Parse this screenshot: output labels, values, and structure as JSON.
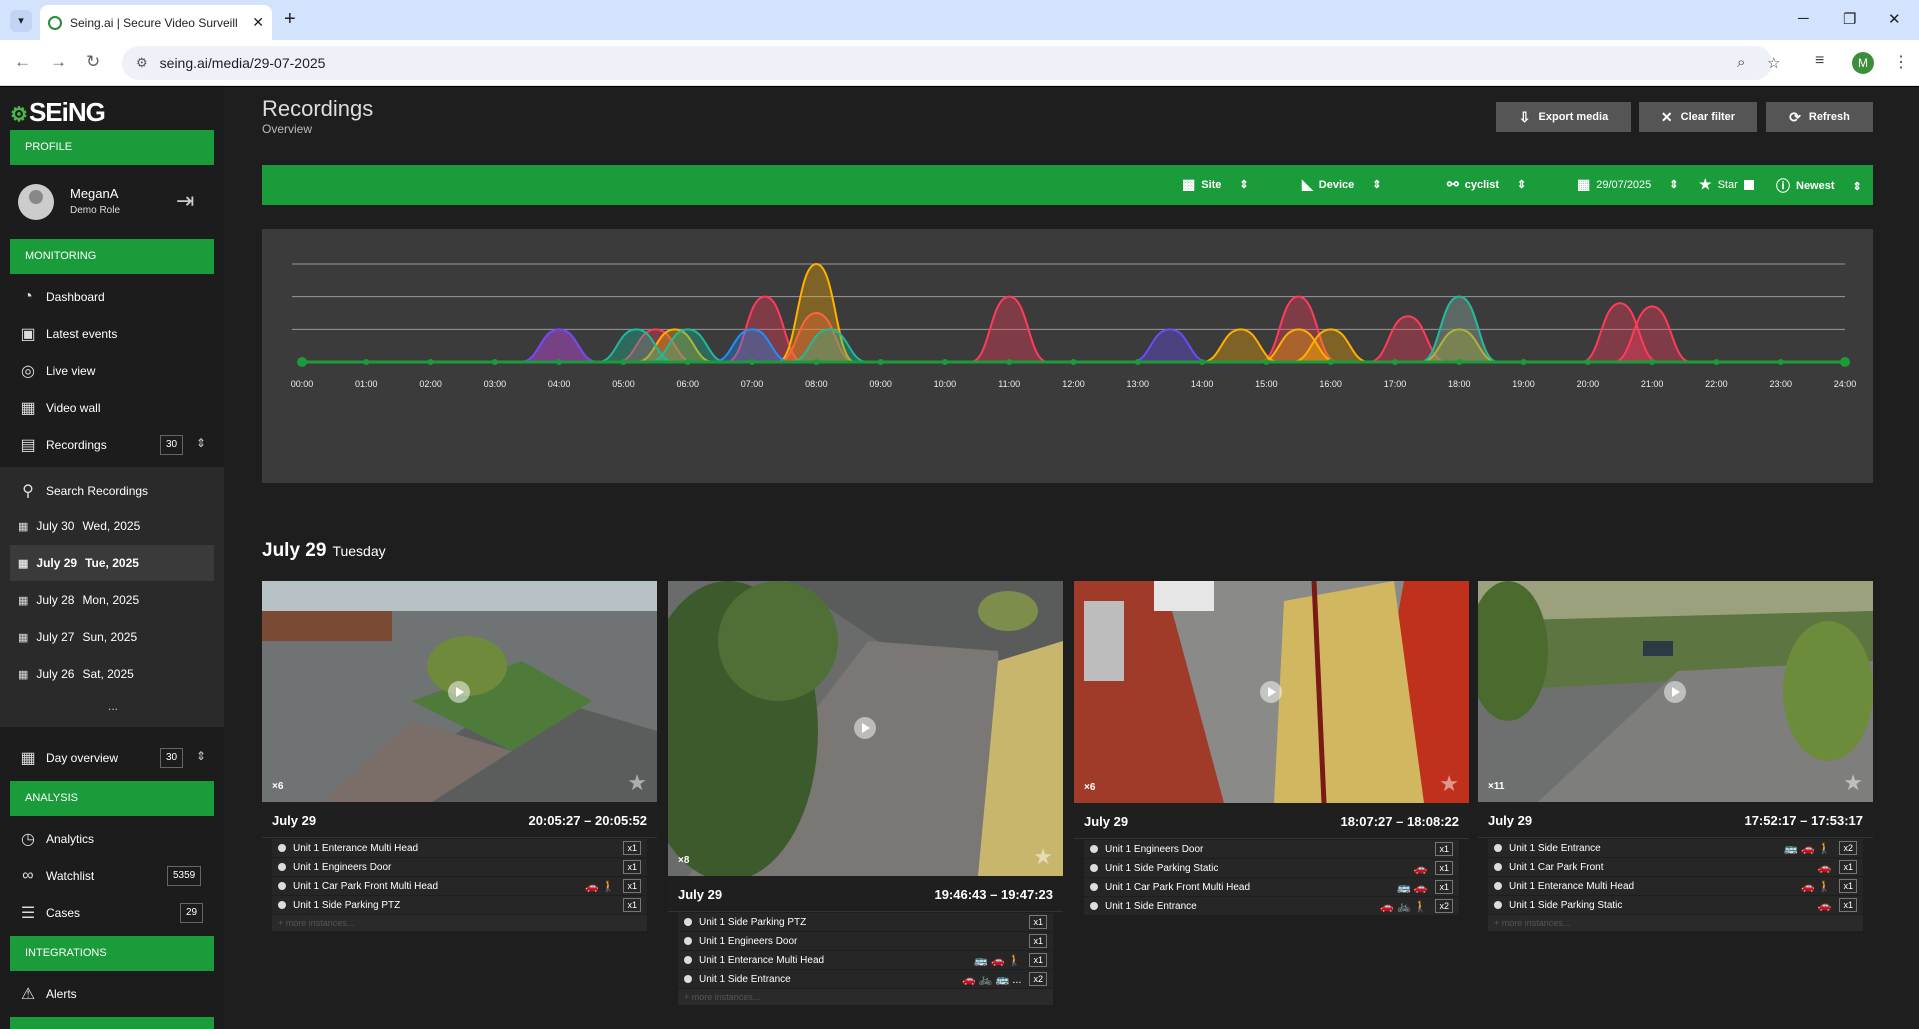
{
  "browser": {
    "tab_title": "Seing.ai | Secure Video Surveill",
    "url": "seing.ai/media/29-07-2025",
    "account_initial": "M"
  },
  "app": {
    "logo": "SEiNG",
    "profile_label": "PROFILE",
    "user_name": "MeganA",
    "user_role": "Demo Role",
    "monitoring_label": "MONITORING",
    "monitoring_items": [
      {
        "label": "Dashboard",
        "icon": "dashboard-icon"
      },
      {
        "label": "Latest events",
        "icon": "image-icon"
      },
      {
        "label": "Live view",
        "icon": "live-icon"
      },
      {
        "label": "Video wall",
        "icon": "grid-icon"
      },
      {
        "label": "Recordings",
        "icon": "clapper-icon",
        "count": "30"
      }
    ],
    "search_recordings": "Search Recordings",
    "days": [
      {
        "day": "July 30",
        "date": "Wed, 2025"
      },
      {
        "day": "July 29",
        "date": "Tue, 2025",
        "selected": true
      },
      {
        "day": "July 28",
        "date": "Mon, 2025"
      },
      {
        "day": "July 27",
        "date": "Sun, 2025"
      },
      {
        "day": "July 26",
        "date": "Sat, 2025"
      }
    ],
    "more_days": "...",
    "day_overview": {
      "label": "Day overview",
      "count": "30"
    },
    "analysis_label": "ANALYSIS",
    "analysis_items": [
      {
        "label": "Analytics"
      },
      {
        "label": "Watchlist",
        "count": "5359"
      },
      {
        "label": "Cases",
        "count": "29"
      }
    ],
    "integrations_label": "INTEGRATIONS",
    "alerts_label": "Alerts"
  },
  "page": {
    "title": "Recordings",
    "subtitle": "Overview",
    "buttons": {
      "export": "Export media",
      "clear": "Clear filter",
      "refresh": "Refresh"
    },
    "filters": {
      "site": "Site",
      "device": "Device",
      "class": "cyclist",
      "date": "29/07/2025",
      "star": "Star",
      "order": "Newest"
    },
    "day_heading": {
      "day": "July 29",
      "weekday": "Tuesday"
    }
  },
  "chart_data": {
    "type": "area",
    "x_ticks": [
      "00:00",
      "01:00",
      "02:00",
      "03:00",
      "04:00",
      "05:00",
      "06:00",
      "07:00",
      "08:00",
      "09:00",
      "10:00",
      "11:00",
      "12:00",
      "13:00",
      "14:00",
      "15:00",
      "16:00",
      "17:00",
      "18:00",
      "19:00",
      "20:00",
      "21:00",
      "22:00",
      "23:00",
      "24:00"
    ],
    "xlim": [
      0,
      24
    ],
    "ylim": [
      0,
      3
    ],
    "grid": true,
    "colors": [
      "#ff3b5c",
      "#ffb000",
      "#6a4cff",
      "#1abc9c",
      "#1e90ff"
    ],
    "series": [
      {
        "color": "#ff3b5c",
        "peaks": [
          [
            4.0,
            1.0
          ],
          [
            5.5,
            1.0
          ],
          [
            7.2,
            2.0
          ],
          [
            8.0,
            1.5
          ],
          [
            11.0,
            2.0
          ],
          [
            15.5,
            2.0
          ],
          [
            17.2,
            1.4
          ],
          [
            18.0,
            2.0
          ],
          [
            20.5,
            1.8
          ],
          [
            21.0,
            1.7
          ]
        ]
      },
      {
        "color": "#ffb000",
        "peaks": [
          [
            5.8,
            1.0
          ],
          [
            8.0,
            3.0
          ],
          [
            14.6,
            1.0
          ],
          [
            15.5,
            1.0
          ],
          [
            16.0,
            1.0
          ],
          [
            18.0,
            1.0
          ]
        ]
      },
      {
        "color": "#6a4cff",
        "peaks": [
          [
            4.0,
            1.0
          ],
          [
            13.5,
            1.0
          ]
        ]
      },
      {
        "color": "#1abc9c",
        "peaks": [
          [
            5.2,
            1.0
          ],
          [
            6.0,
            1.0
          ],
          [
            8.2,
            1.0
          ],
          [
            18.0,
            2.0
          ]
        ]
      },
      {
        "color": "#1e90ff",
        "peaks": [
          [
            7.0,
            1.0
          ]
        ]
      }
    ]
  },
  "cards": [
    {
      "date": "July 29",
      "time": "20:05:27 – 20:05:52",
      "count": "×6",
      "instances": [
        {
          "name": "Unit 1 Enterance Multi Head",
          "icons": "",
          "x": "x1"
        },
        {
          "name": "Unit 1 Engineers Door",
          "icons": "",
          "x": "x1"
        },
        {
          "name": "Unit 1 Car Park Front Multi Head",
          "icons": "🚗 🚶",
          "x": "x1"
        },
        {
          "name": "Unit 1 Side Parking PTZ",
          "icons": "",
          "x": "x1"
        }
      ],
      "more": "+ more instances..."
    },
    {
      "date": "July 29",
      "time": "19:46:43 – 19:47:23",
      "count": "×8",
      "instances": [
        {
          "name": "Unit 1 Side Parking PTZ",
          "icons": "",
          "x": "x1"
        },
        {
          "name": "Unit 1 Engineers Door",
          "icons": "",
          "x": "x1"
        },
        {
          "name": "Unit 1 Enterance Multi Head",
          "icons": "🚌 🚗 🚶",
          "x": "x1"
        },
        {
          "name": "Unit 1 Side Entrance",
          "icons": "🚗 🚲 🚌 ...",
          "x": "x2"
        }
      ],
      "more": "+ more instances..."
    },
    {
      "date": "July 29",
      "time": "18:07:27 – 18:08:22",
      "count": "×6",
      "instances": [
        {
          "name": "Unit 1 Engineers Door",
          "icons": "",
          "x": "x1"
        },
        {
          "name": "Unit 1 Side Parking Static",
          "icons": "🚗",
          "x": "x1"
        },
        {
          "name": "Unit 1 Car Park Front Multi Head",
          "icons": "🚌 🚗",
          "x": "x1"
        },
        {
          "name": "Unit 1 Side Entrance",
          "icons": "🚗 🚲 🚶",
          "x": "x2"
        }
      ],
      "more": ""
    },
    {
      "date": "July 29",
      "time": "17:52:17 – 17:53:17",
      "count": "×11",
      "instances": [
        {
          "name": "Unit 1 Side Entrance",
          "icons": "🚌 🚗 🚶",
          "x": "x2"
        },
        {
          "name": "Unit 1 Car Park Front",
          "icons": "🚗",
          "x": "x1"
        },
        {
          "name": "Unit 1 Enterance Multi Head",
          "icons": "🚗 🚶",
          "x": "x1"
        },
        {
          "name": "Unit 1 Side Parking Static",
          "icons": "🚗",
          "x": "x1"
        }
      ],
      "more": "+ more instances..."
    }
  ]
}
